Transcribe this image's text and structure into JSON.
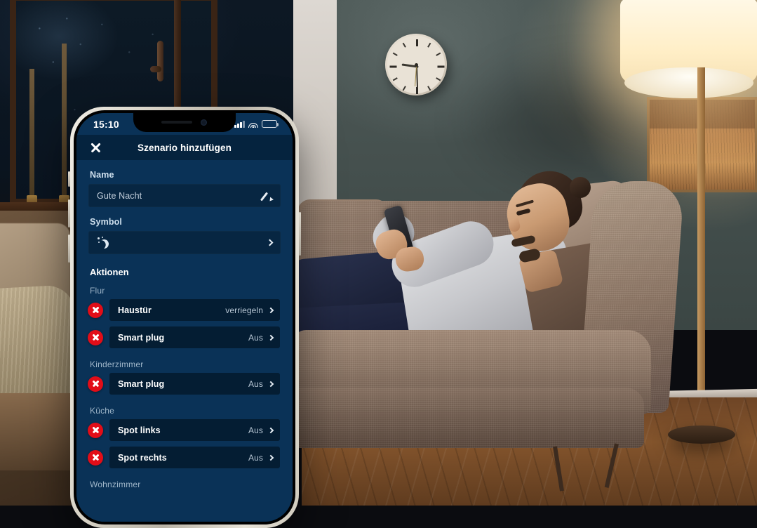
{
  "phone": {
    "status_bar": {
      "time": "15:10",
      "cellular_icon": "signal-bars-icon",
      "wifi_icon": "wifi-icon",
      "battery_icon": "battery-icon"
    }
  },
  "app": {
    "header": {
      "close_icon": "close-icon",
      "title": "Szenario hinzufügen"
    },
    "name_section": {
      "label": "Name",
      "value": "Gute Nacht",
      "edit_icon": "pencil-icon"
    },
    "symbol_section": {
      "label": "Symbol",
      "icon": "moon-stars-icon",
      "chevron_icon": "chevron-right-icon"
    },
    "actions_section": {
      "title": "Aktionen",
      "rooms": [
        {
          "name": "Flur",
          "actions": [
            {
              "delete_icon": "delete-circle-icon",
              "device": "Haustür",
              "state": "verriegeln",
              "chevron_icon": "chevron-right-icon"
            },
            {
              "delete_icon": "delete-circle-icon",
              "device": "Smart plug",
              "state": "Aus",
              "chevron_icon": "chevron-right-icon"
            }
          ]
        },
        {
          "name": "Kinderzimmer",
          "actions": [
            {
              "delete_icon": "delete-circle-icon",
              "device": "Smart plug",
              "state": "Aus",
              "chevron_icon": "chevron-right-icon"
            }
          ]
        },
        {
          "name": "Küche",
          "actions": [
            {
              "delete_icon": "delete-circle-icon",
              "device": "Spot links",
              "state": "Aus",
              "chevron_icon": "chevron-right-icon"
            },
            {
              "delete_icon": "delete-circle-icon",
              "device": "Spot rechts",
              "state": "Aus",
              "chevron_icon": "chevron-right-icon"
            }
          ]
        },
        {
          "name": "Wohnzimmer",
          "actions": []
        }
      ]
    }
  },
  "colors": {
    "app_background": "#0a3257",
    "header_background": "#05233e",
    "field_background": "#072642",
    "card_background": "#041d33",
    "delete_red": "#e20d18",
    "text_primary": "#ffffff",
    "text_secondary": "#b7c6d4",
    "room_label": "#9fb6c9"
  }
}
